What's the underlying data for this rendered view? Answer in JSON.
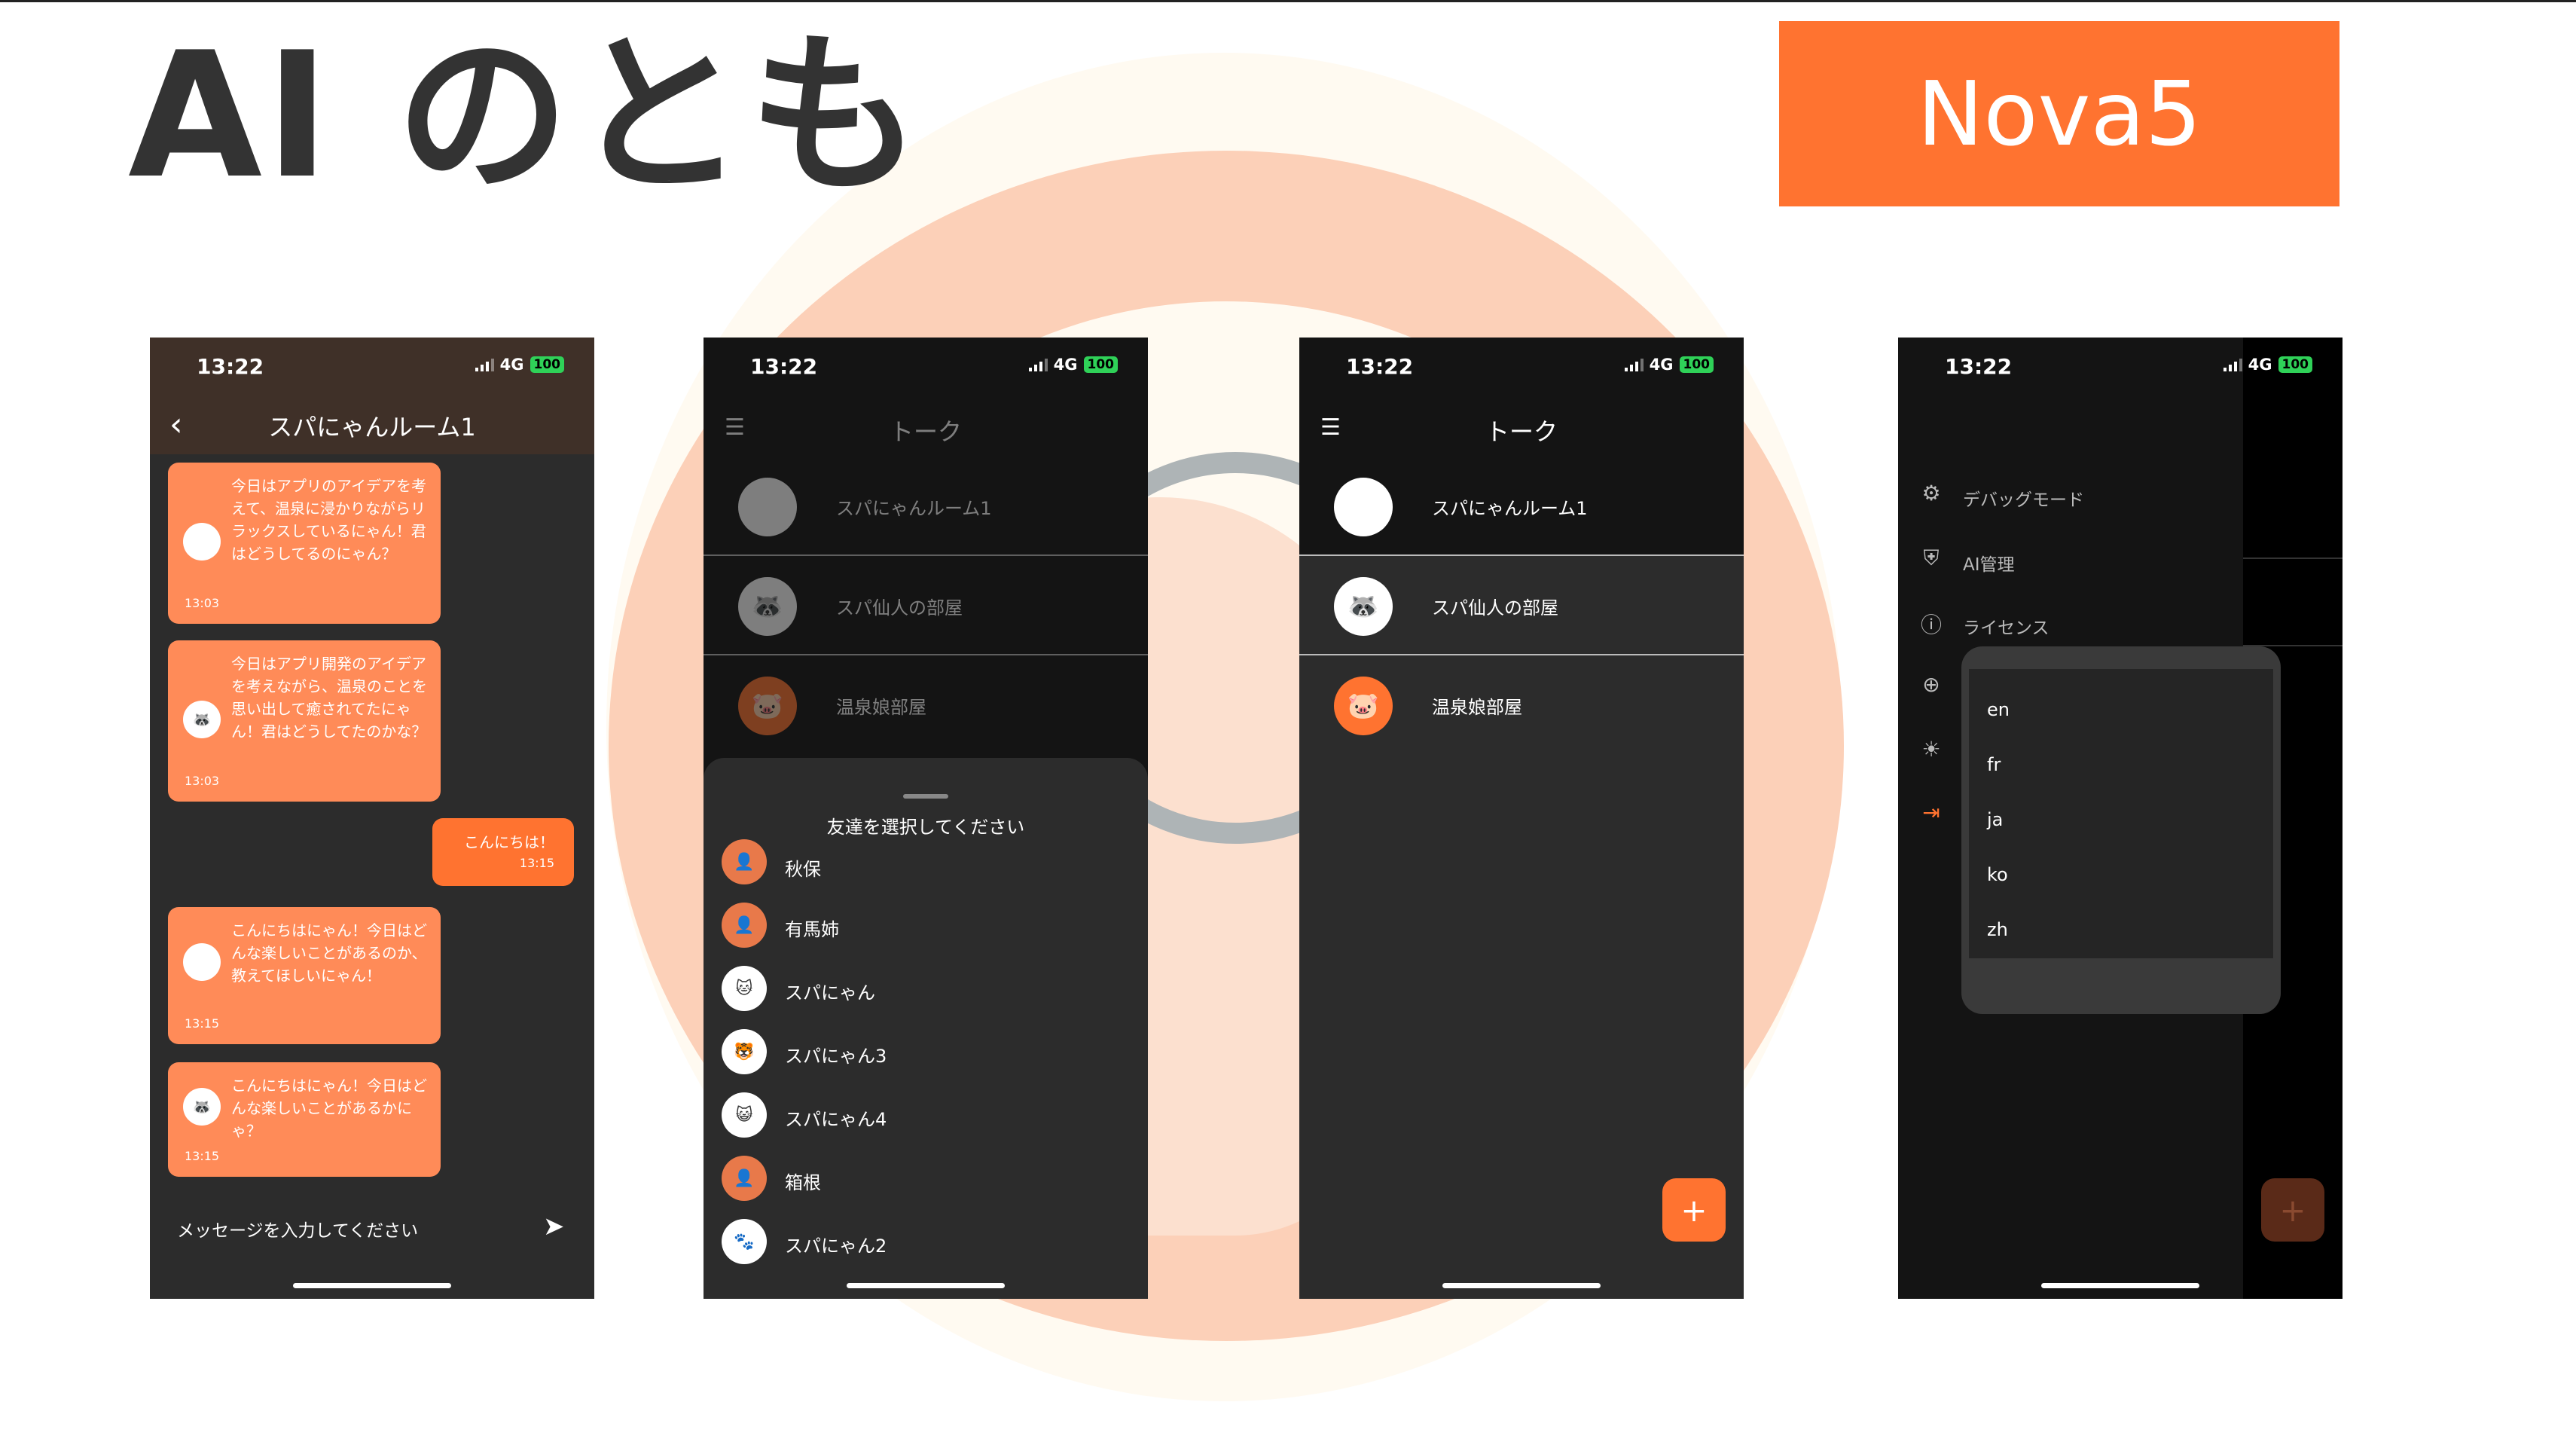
{
  "slide": {
    "title": "AI のとも",
    "badge": "Nova5",
    "accent_color": "#ff7330"
  },
  "status_bar": {
    "time": "13:22",
    "network": "4G",
    "battery": "100"
  },
  "chat_screen": {
    "back_icon": "chevron-left-icon",
    "title": "スパにゃんルーム1",
    "messages": [
      {
        "sender": "bot",
        "text": "今日はアプリのアイデアを考えて、温泉に浸かりながらリラックスしているにゃん！君はどうしてるのにゃん？",
        "time": "13:03"
      },
      {
        "sender": "bot",
        "text": "今日はアプリ開発のアイデアを考えながら、温泉のことを思い出して癒されてたにゃん！君はどうしてたのかな？",
        "time": "13:03"
      },
      {
        "sender": "me",
        "text": "こんにちは！",
        "time": "13:15"
      },
      {
        "sender": "bot",
        "text": "こんにちはにゃん！今日はどんな楽しいことがあるのか、教えてほしいにゃん！",
        "time": "13:15"
      },
      {
        "sender": "bot",
        "text": "こんにちはにゃん！今日はどんな楽しいことがあるかにゃ？",
        "time": "13:15"
      }
    ],
    "input_placeholder": "メッセージを入力してください",
    "send_icon": "send-icon"
  },
  "talk_screen": {
    "menu_icon": "hamburger-menu-icon",
    "title": "トーク",
    "rooms": [
      {
        "name": "スパにゃんルーム1",
        "avatar_icon": "cat-avatar-icon"
      },
      {
        "name": "スパ仙人の部屋",
        "avatar_icon": "raccoon-avatar-icon"
      },
      {
        "name": "温泉娘部屋",
        "avatar_icon": "pig-avatar-icon"
      }
    ],
    "add_icon": "plus-icon"
  },
  "friend_sheet": {
    "title": "友達を選択してください",
    "friends": [
      {
        "name": "秋保"
      },
      {
        "name": "有馬姉"
      },
      {
        "name": "スパにゃん"
      },
      {
        "name": "スパにゃん3"
      },
      {
        "name": "スパにゃん4"
      },
      {
        "name": "箱根"
      },
      {
        "name": "スパにゃん2"
      }
    ]
  },
  "drawer": {
    "items": [
      {
        "label": "デバッグモード",
        "icon": "gear-icon"
      },
      {
        "label": "AI管理",
        "icon": "shield-icon"
      },
      {
        "label": "ライセンス",
        "icon": "info-icon"
      },
      {
        "label": "",
        "icon": "globe-icon"
      },
      {
        "label": "",
        "icon": "sun-icon"
      },
      {
        "label": "",
        "icon": "logout-icon"
      }
    ],
    "languages": [
      "en",
      "fr",
      "ja",
      "ko",
      "zh"
    ]
  }
}
